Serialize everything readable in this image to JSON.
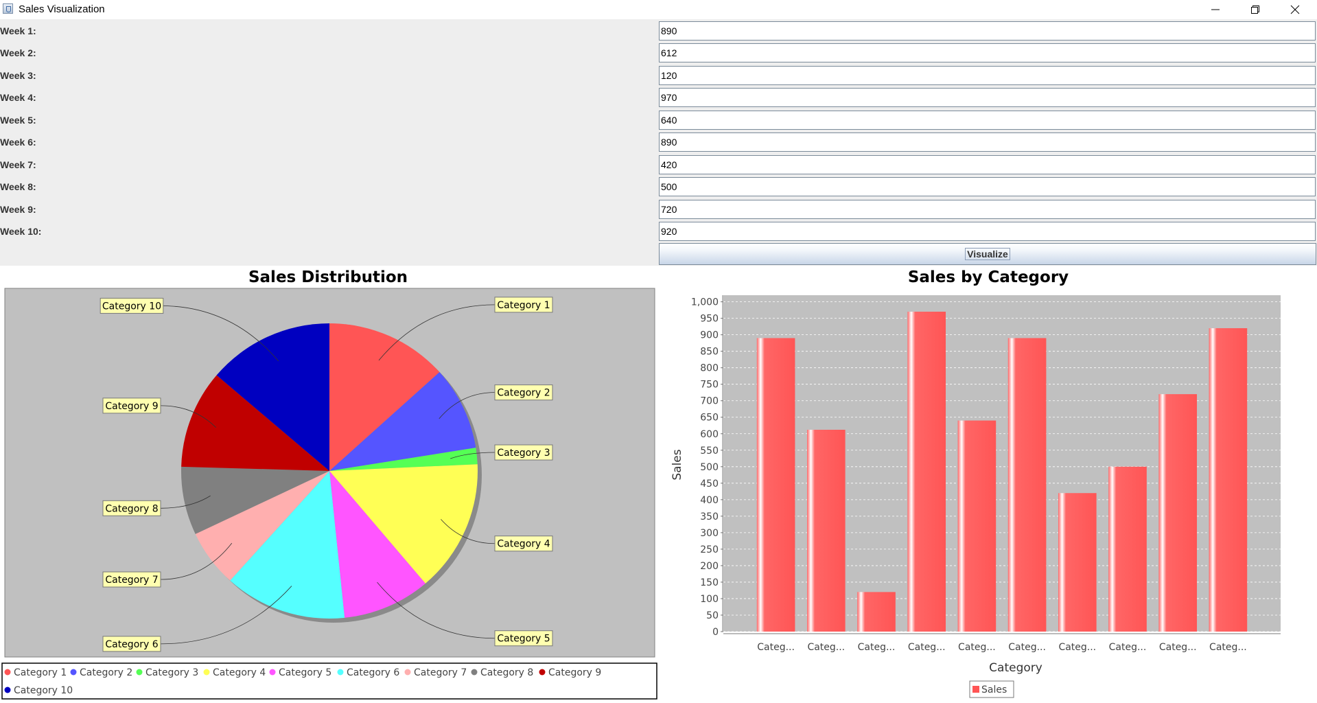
{
  "window": {
    "title": "Sales Visualization",
    "controls": [
      "minimize-icon",
      "restore-icon",
      "close-icon"
    ]
  },
  "form": {
    "weeks": [
      {
        "label": "Week 1:",
        "value": "890"
      },
      {
        "label": "Week 2:",
        "value": "612"
      },
      {
        "label": "Week 3:",
        "value": "120"
      },
      {
        "label": "Week 4:",
        "value": "970"
      },
      {
        "label": "Week 5:",
        "value": "640"
      },
      {
        "label": "Week 6:",
        "value": "890"
      },
      {
        "label": "Week 7:",
        "value": "420"
      },
      {
        "label": "Week 8:",
        "value": "500"
      },
      {
        "label": "Week 9:",
        "value": "720"
      },
      {
        "label": "Week 10:",
        "value": "920"
      }
    ],
    "visualize_label": "Visualize"
  },
  "chart_data": [
    {
      "type": "pie",
      "title": "Sales Distribution",
      "categories": [
        "Category 1",
        "Category 2",
        "Category 3",
        "Category 4",
        "Category 5",
        "Category 6",
        "Category 7",
        "Category 8",
        "Category 9",
        "Category 10"
      ],
      "values": [
        890,
        612,
        120,
        970,
        640,
        890,
        420,
        500,
        720,
        920
      ],
      "colors": [
        "#ff5555",
        "#5555ff",
        "#55ff55",
        "#ffff55",
        "#ff55ff",
        "#55ffff",
        "#ffafaf",
        "#808080",
        "#c00000",
        "#0000c0"
      ],
      "legend_position": "bottom",
      "background": "#c0c0c0"
    },
    {
      "type": "bar",
      "title": "Sales by Category",
      "xlabel": "Category",
      "ylabel": "Sales",
      "categories": [
        "Category 1",
        "Category 2",
        "Category 3",
        "Category 4",
        "Category 5",
        "Category 6",
        "Category 7",
        "Category 8",
        "Category 9",
        "Category 10"
      ],
      "tick_labels": [
        "Categ...",
        "Categ...",
        "Categ...",
        "Categ...",
        "Categ...",
        "Categ...",
        "Categ...",
        "Categ...",
        "Categ...",
        "Categ..."
      ],
      "y_ticks": [
        "0",
        "50",
        "100",
        "150",
        "200",
        "250",
        "300",
        "350",
        "400",
        "450",
        "500",
        "550",
        "600",
        "650",
        "700",
        "750",
        "800",
        "850",
        "900",
        "950",
        "1,000"
      ],
      "series": [
        {
          "name": "Sales",
          "values": [
            890,
            612,
            120,
            970,
            640,
            890,
            420,
            500,
            720,
            920
          ],
          "color": "#ff5555"
        }
      ],
      "ylim": [
        0,
        1020
      ],
      "grid": true,
      "legend_position": "bottom",
      "background": "#c0c0c0"
    }
  ]
}
